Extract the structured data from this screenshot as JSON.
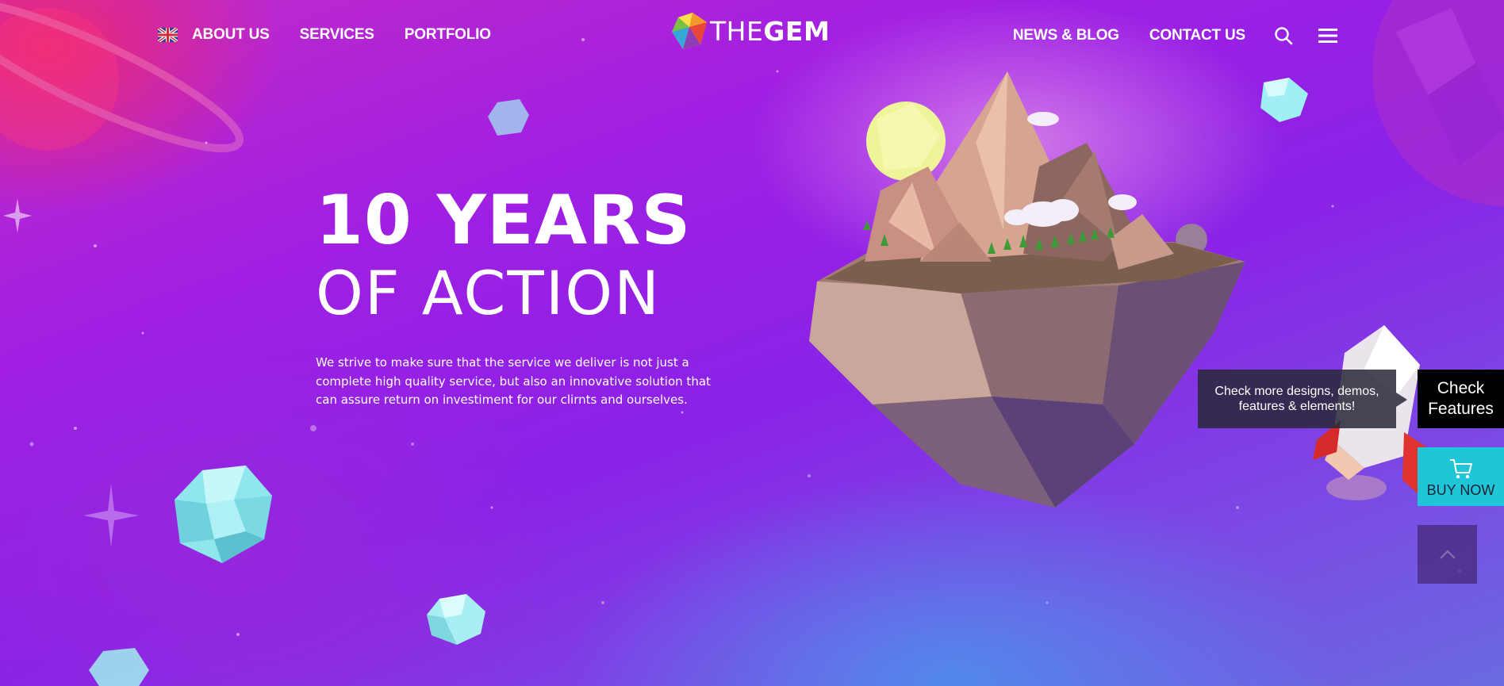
{
  "header": {
    "left_nav": [
      {
        "label": "ABOUT US"
      },
      {
        "label": "SERVICES"
      },
      {
        "label": "PORTFOLIO"
      }
    ],
    "logo": {
      "prefix": "THE",
      "suffix": "GEM"
    },
    "right_nav": [
      {
        "label": "NEWS & BLOG"
      },
      {
        "label": "CONTACT US"
      }
    ],
    "icons": [
      "flag-uk-icon",
      "search-icon",
      "menu-icon"
    ]
  },
  "hero": {
    "title": "10 YEARS",
    "subtitle": "OF ACTION",
    "description": "We strive to make sure that the service we deliver is not just a complete high quality service, but also an innovative solution that can assure return on investiment for our clirnts and ourselves."
  },
  "side_panel": {
    "tooltip": "Check more designs, demos, features & elements!",
    "check_features": "Check Features",
    "buy_now": "BUY NOW",
    "icons": [
      "cart-icon",
      "chevron-up-icon"
    ]
  },
  "colors": {
    "background_primary": "#9a22e4",
    "background_pink": "#ec286e",
    "background_blue": "#508ceb",
    "buy_now": "#1ec6d8",
    "check_features": "#000000",
    "text": "#ffffff"
  }
}
